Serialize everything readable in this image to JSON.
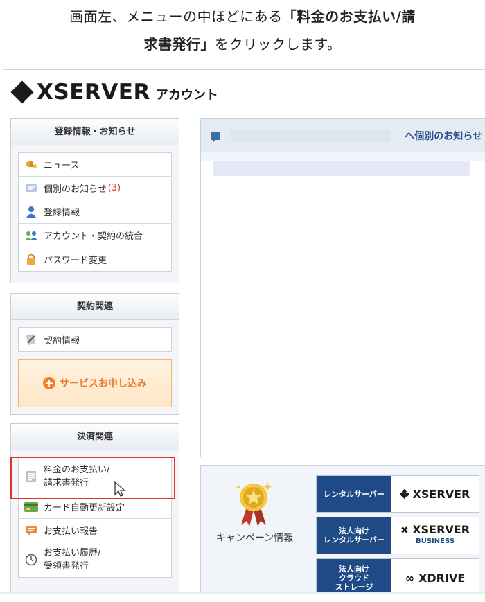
{
  "instruction": {
    "line1_pre": "画面左、メニューの中ほどにある",
    "line1_bold": "「料金のお支払い/請",
    "line2_bold": "求書発行」",
    "line2_post": "をクリックします。"
  },
  "header": {
    "logo_text": "XSERVER",
    "logo_sub": "アカウント"
  },
  "panels": {
    "account": {
      "title": "登録情報・お知らせ",
      "items": [
        {
          "label": "ニュース",
          "icon": "megaphone-icon"
        },
        {
          "label": "個別のお知らせ",
          "count": "(3)",
          "icon": "message-icon"
        },
        {
          "label": "登録情報",
          "icon": "user-icon"
        },
        {
          "label": "アカウント・契約の統合",
          "icon": "users-icon"
        },
        {
          "label": "パスワード変更",
          "icon": "lock-icon"
        }
      ]
    },
    "contract": {
      "title": "契約関連",
      "items": [
        {
          "label": "契約情報",
          "icon": "contract-icon"
        }
      ],
      "service_button": "サービスお申し込み"
    },
    "payment": {
      "title": "決済関連",
      "items": [
        {
          "line1": "料金のお支払い/",
          "line2": "請求書発行",
          "icon": "invoice-icon"
        },
        {
          "label": "カード自動更新設定",
          "icon": "credit-card-icon"
        },
        {
          "label": "お支払い報告",
          "icon": "report-icon"
        },
        {
          "line1": "お支払い履歴/",
          "line2": "受領書発行",
          "icon": "clock-icon"
        }
      ]
    }
  },
  "notice": {
    "link": "へ個別のお知らせ"
  },
  "campaign": {
    "label": "キャンペーン情報",
    "banners": [
      {
        "left": "レンタルサーバー",
        "right": "XSERVER"
      },
      {
        "left_line1": "法人向け",
        "left_line2": "レンタルサーバー",
        "right": "XSERVER",
        "right_sub": "BUSINESS"
      },
      {
        "left_line1": "法人向け",
        "left_line2": "クラウド",
        "left_line3": "ストレージ",
        "right": "XDRIVE"
      }
    ]
  },
  "colors": {
    "highlight": "#e0332d",
    "count": "#d93a2b",
    "service": "#e8782a",
    "banner": "#1e4a86"
  }
}
